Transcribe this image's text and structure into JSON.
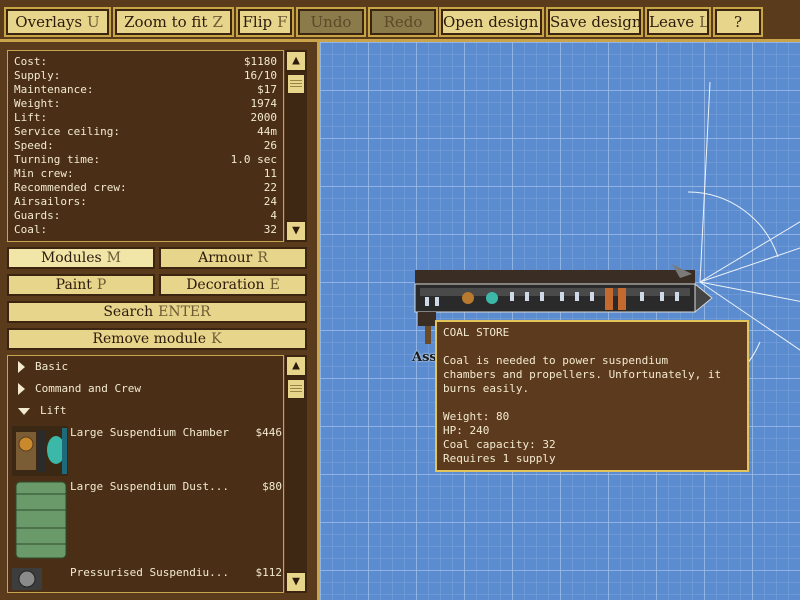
{
  "toolbar": {
    "buttons": [
      {
        "label": "Overlays",
        "key": "U",
        "enabled": true
      },
      {
        "label": "Zoom to fit",
        "key": "Z",
        "enabled": true
      },
      {
        "label": "Flip",
        "key": "F",
        "enabled": true
      },
      {
        "label": "Undo",
        "key": "",
        "enabled": false
      },
      {
        "label": "Redo",
        "key": "",
        "enabled": false
      },
      {
        "label": "Open design",
        "key": "O",
        "enabled": true
      },
      {
        "label": "Save design",
        "key": "V",
        "enabled": true
      },
      {
        "label": "Leave",
        "key": "L",
        "enabled": true
      },
      {
        "label": "?",
        "key": "",
        "enabled": true
      }
    ]
  },
  "stats": [
    {
      "label": "Cost:",
      "value": "$1180"
    },
    {
      "label": "Supply:",
      "value": "16/10"
    },
    {
      "label": "Maintenance:",
      "value": "$17"
    },
    {
      "label": "Weight:",
      "value": "1974"
    },
    {
      "label": "Lift:",
      "value": "2000"
    },
    {
      "label": "Service ceiling:",
      "value": "44m"
    },
    {
      "label": "Speed:",
      "value": "26"
    },
    {
      "label": "Turning time:",
      "value": "1.0 sec"
    },
    {
      "label": "Min crew:",
      "value": "11"
    },
    {
      "label": "Recommended crew:",
      "value": "22"
    },
    {
      "label": "Airsailors:",
      "value": "24"
    },
    {
      "label": "Guards:",
      "value": "4"
    },
    {
      "label": "Coal:",
      "value": "32"
    }
  ],
  "panel_buttons": {
    "modules": {
      "label": "Modules",
      "key": "M"
    },
    "armour": {
      "label": "Armour",
      "key": "R"
    },
    "paint": {
      "label": "Paint",
      "key": "P"
    },
    "decoration": {
      "label": "Decoration",
      "key": "E"
    },
    "search": {
      "label": "Search",
      "key": "ENTER"
    },
    "remove": {
      "label": "Remove module",
      "key": "K"
    }
  },
  "categories": [
    {
      "label": "Basic",
      "open": false
    },
    {
      "label": "Command and Crew",
      "open": false
    },
    {
      "label": "Lift",
      "open": true
    }
  ],
  "modules": [
    {
      "name": "Large Suspendium Chamber",
      "price": "$446"
    },
    {
      "name": "Large Suspendium Dust...",
      "price": "$80"
    },
    {
      "name": "Pressurised Suspendiu...",
      "price": "$112"
    }
  ],
  "canvas": {
    "ship_label_fragment": "Assa"
  },
  "tooltip": {
    "title": "COAL STORE",
    "desc_line1": "Coal is needed to power suspendium",
    "desc_line2": "chambers and propellers. Unfortunately, it",
    "desc_line3": "burns easily.",
    "weight": "Weight: 80",
    "hp": "HP: 240",
    "coal": "Coal capacity: 32",
    "supply": "Requires 1 supply"
  },
  "colors": {
    "accent_gold": "#e6d58a",
    "panel_brown": "#4a2f16",
    "blueprint": "#5a8ccf"
  }
}
